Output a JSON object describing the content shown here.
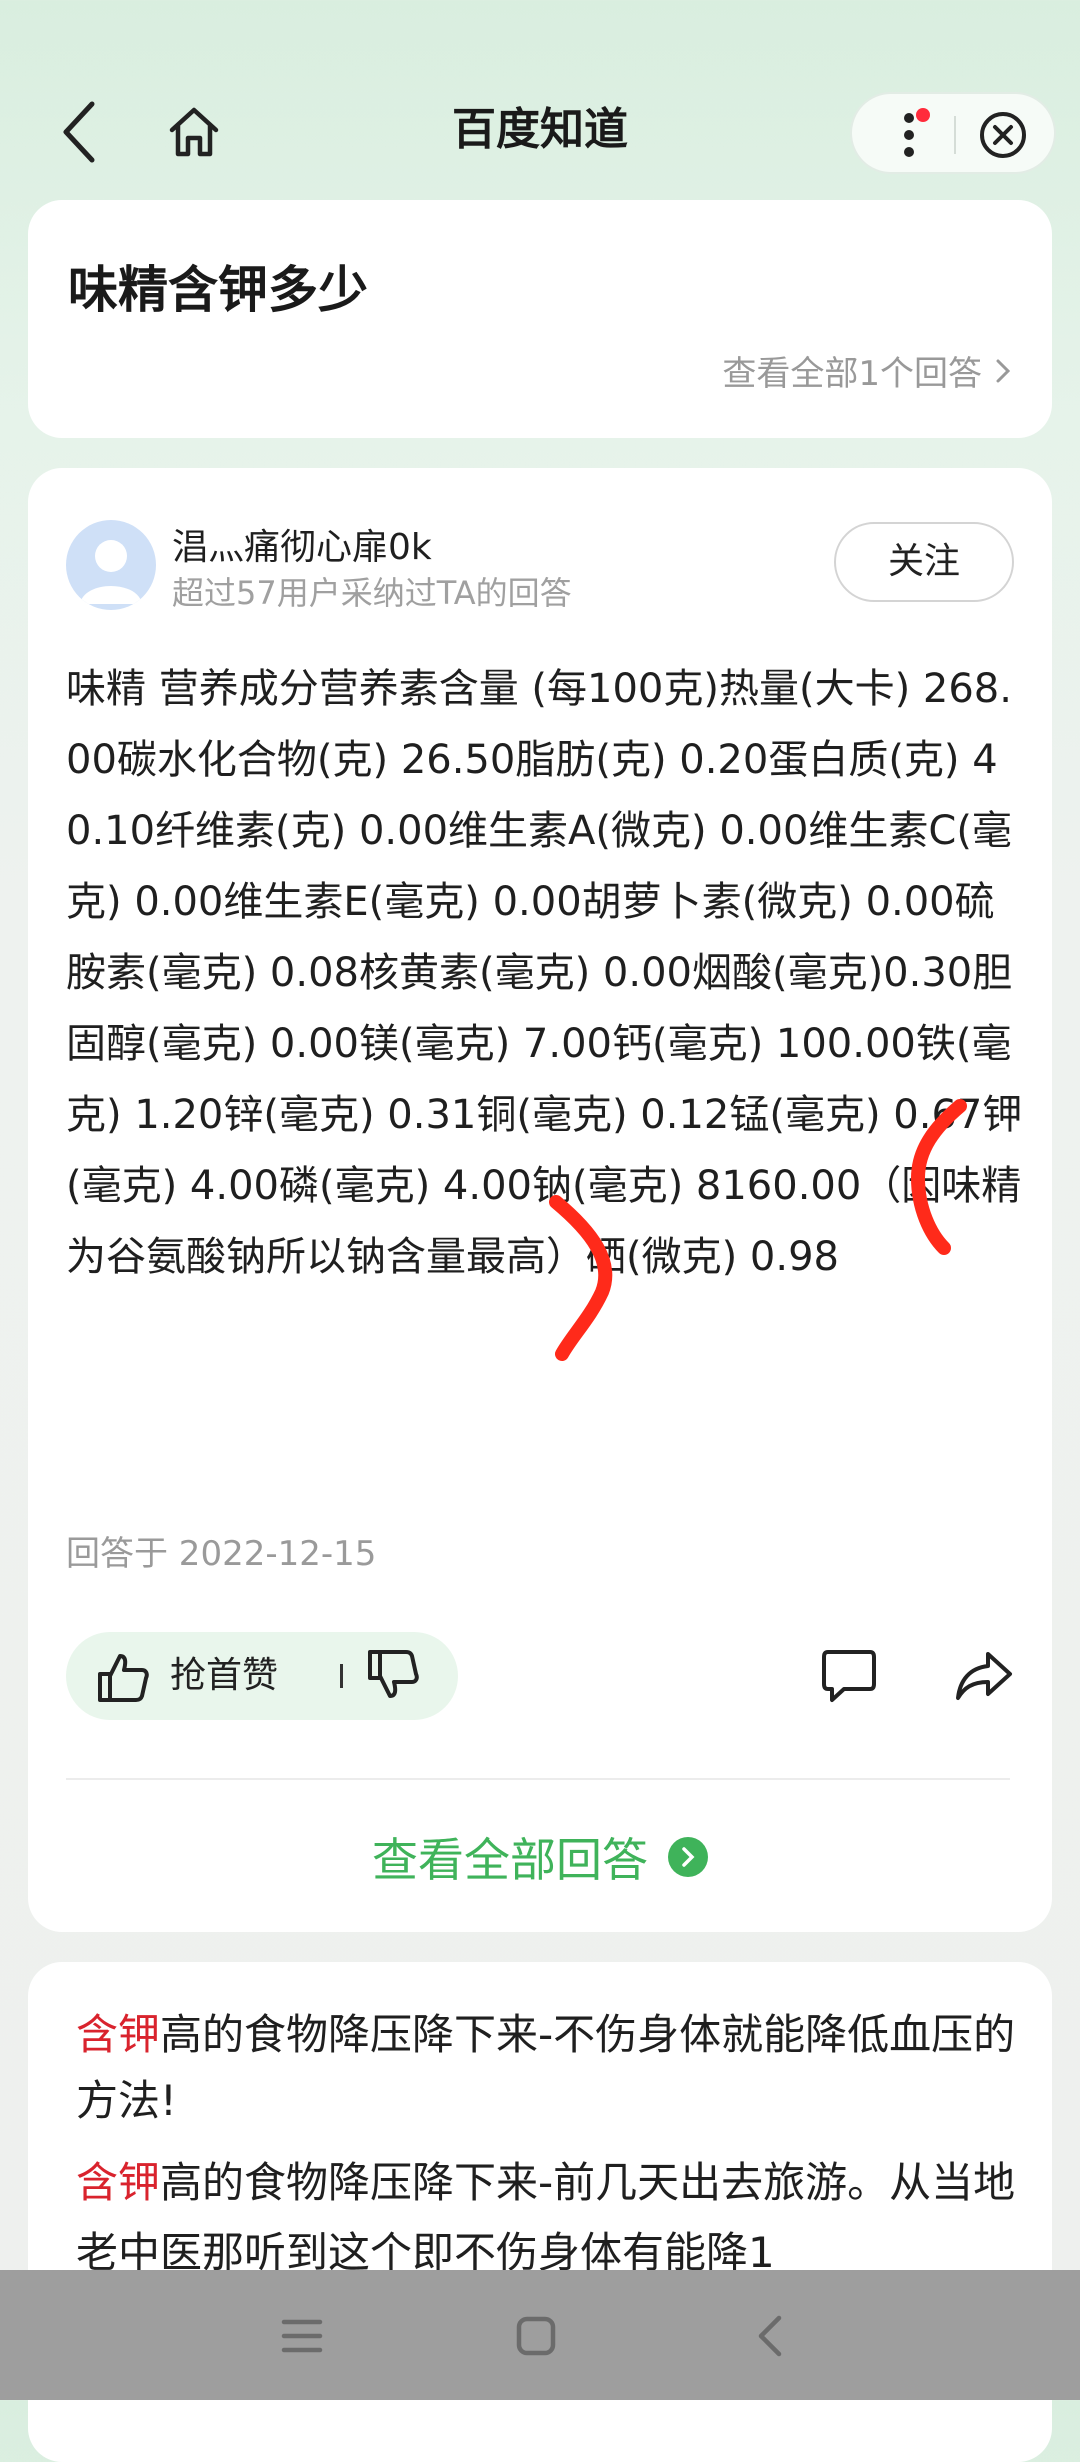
{
  "header": {
    "title": "百度知道"
  },
  "question": {
    "title": "味精含钾多少",
    "see_all": "查看全部1个回答"
  },
  "answer": {
    "user_name": "淐灬痛彻心扉0k",
    "user_sub": "超过57用户采纳过TA的回答",
    "follow_label": "关注",
    "text": "味精 营养成分营养素含量 (每100克)热量(大卡) 268.00碳水化合物(克) 26.50脂肪(克) 0.20蛋白质(克) 40.10纤维素(克) 0.00维生素A(微克) 0.00维生素C(毫克) 0.00维生素E(毫克) 0.00胡萝卜素(微克) 0.00硫胺素(毫克) 0.08核黄素(毫克) 0.00烟酸(毫克)0.30胆固醇(毫克) 0.00镁(毫克) 7.00钙(毫克) 100.00铁(毫克) 1.20锌(毫克) 0.31铜(毫克) 0.12锰(毫克) 0.67钾(毫克) 4.00磷(毫克) 4.00钠(毫克) 8160.00（因味精为谷氨酸钠所以钠含量最高）硒(微克) 0.98",
    "date": "回答于 2022-12-15",
    "like_label": "抢首赞",
    "see_all_answers": "查看全部回答"
  },
  "ad": {
    "title_highlight": "含钾",
    "title_rest": "高的食物降压降下来-不伤身体就能降低血压的方法!",
    "body_highlight": "含钾",
    "body_rest": "高的食物降压降下来-前几天出去旅游。从当地老中医那听到这个即不伤身体有能降1"
  },
  "colors": {
    "accent_green": "#3fb35a",
    "highlight_red": "#d9232d",
    "annotation_red": "#ff2a1a"
  },
  "icons": [
    "back-icon",
    "home-icon",
    "more-icon",
    "close-icon",
    "thumb-up-icon",
    "thumb-down-icon",
    "comment-icon",
    "share-icon",
    "chevron-right-icon",
    "menu-icon",
    "square-icon"
  ]
}
